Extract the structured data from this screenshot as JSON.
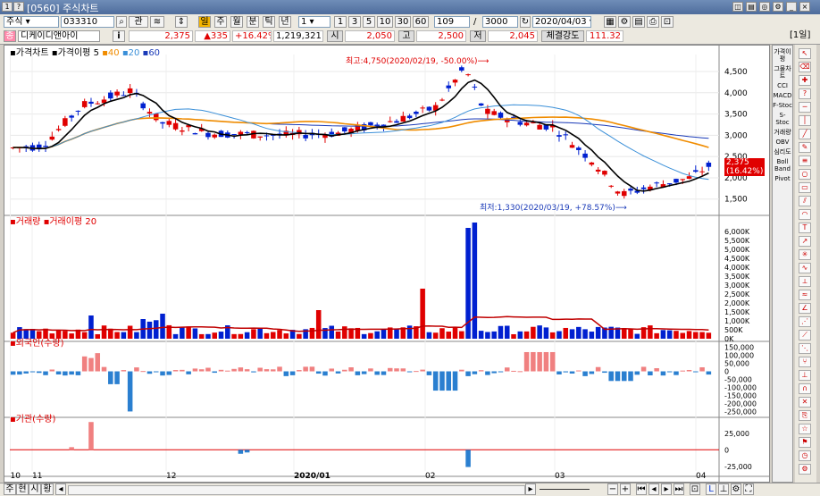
{
  "window": {
    "title": "[0560] 주식차트"
  },
  "toolbar": {
    "market": "주식",
    "code": "033310",
    "btn_gwan": "관",
    "btn_il": "일",
    "period_tabs": [
      "주",
      "월",
      "분",
      "틱",
      "년"
    ],
    "minute_value": "1",
    "interval_buttons": [
      "1",
      "3",
      "5",
      "10",
      "30",
      "60"
    ],
    "count": "109",
    "slash": "/",
    "total": "3000",
    "date": "2020/04/03"
  },
  "quote": {
    "name": "디케이디앤아이",
    "info": "i",
    "price": "2,375",
    "change": "▲335",
    "change_pct": "+16.42%",
    "volume": "1,219,321",
    "open_label": "시",
    "open": "2,050",
    "high_label": "고",
    "high": "2,500",
    "low_label": "저",
    "low": "2,045",
    "strength_label": "체결강도",
    "strength": "111.32",
    "day_badge": "[1일]"
  },
  "price_panel": {
    "legend_title": "가격차트",
    "legend_ma": "가격이평",
    "ma_periods": [
      "5",
      "40",
      "20",
      "60"
    ],
    "high_note": "최고:4,750(2020/02/19, -50.00%)",
    "low_note": "최저:1,330(2020/03/19, +78.57%)",
    "ticks": [
      "4,500",
      "4,000",
      "3,500",
      "3,000",
      "2,500",
      "2,000",
      "1,500"
    ],
    "current_price": "2,375",
    "current_pct": "(16.42%)"
  },
  "volume_panel": {
    "legend_title": "거래량",
    "legend_ma": "거래이평 20",
    "ticks": [
      "6,000K",
      "5,500K",
      "5,000K",
      "4,500K",
      "4,000K",
      "3,500K",
      "3,000K",
      "2,500K",
      "2,000K",
      "1,500K",
      "1,000K",
      "500K",
      "0K"
    ]
  },
  "foreign_panel": {
    "legend_title": "외국인(수량)",
    "ticks": [
      "150,000",
      "100,000",
      "50,000",
      "0",
      "-50,000",
      "-100,000",
      "-150,000",
      "-200,000",
      "-250,000"
    ]
  },
  "inst_panel": {
    "legend_title": "기관(수량)",
    "ticks": [
      "25,000",
      "0",
      "-25,000"
    ]
  },
  "x_axis": {
    "labels": [
      "10",
      "11",
      "12",
      "2020/01",
      "02",
      "03",
      "04"
    ]
  },
  "right_indicators": [
    "가격이평",
    "그물차트",
    "CCI",
    "MACD",
    "F-Stoc",
    "S-Stoc",
    "거래량",
    "OBV",
    "심리도",
    "Boll Band",
    "Pivot"
  ],
  "bottom_tabs": [
    "주",
    "현",
    "시",
    "황"
  ],
  "colors": {
    "up": "#e00000",
    "down": "#0020d0",
    "ma5": "#000000",
    "ma20": "#3a8fd8",
    "ma40": "#f08c00",
    "ma60": "#1a3ab8"
  },
  "chart_data": {
    "type": "candlestick",
    "x_range": [
      "2019/10/31",
      "2020/04/03"
    ],
    "close_start": 2700,
    "close_end": 2375,
    "ylim_price": [
      1200,
      4900
    ],
    "ylim_volume_k": [
      0,
      6500
    ],
    "series": [
      {
        "name": "가격이평 5",
        "values_note": "follows close"
      },
      {
        "name": "40"
      },
      {
        "name": "20"
      },
      {
        "name": "60"
      }
    ]
  }
}
